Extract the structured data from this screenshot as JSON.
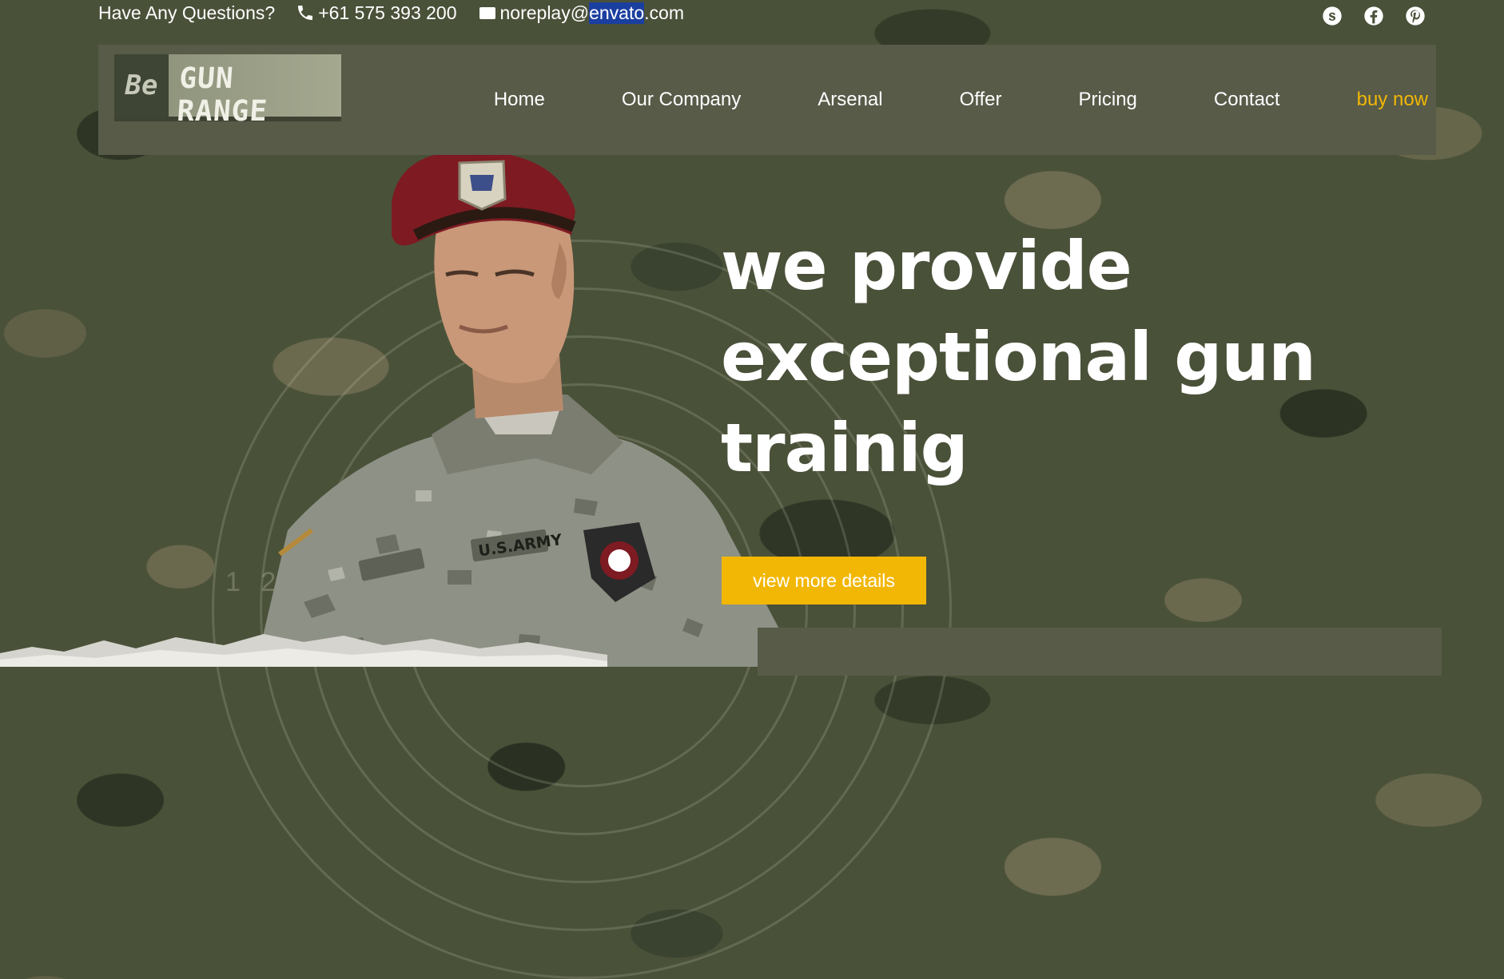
{
  "topbar": {
    "question": "Have Any Questions?",
    "phone": "+61 575 393 200",
    "email_prefix": "noreplay@",
    "email_domain": "envato",
    "email_suffix": ".com",
    "icons": [
      "phone-icon",
      "envelope-icon"
    ]
  },
  "socials": [
    "skype-icon",
    "facebook-icon",
    "pinterest-icon"
  ],
  "logo": {
    "be": "Be",
    "name": "GUN RANGE"
  },
  "nav": {
    "items": [
      "Home",
      "Our Company",
      "Arsenal",
      "Offer",
      "Pricing",
      "Contact"
    ],
    "buy": "buy now"
  },
  "hero": {
    "line1": "we provide",
    "line2": "exceptional gun",
    "line3": "trainig",
    "cta": "view more details",
    "target_numbers": "1 2 3"
  },
  "colors": {
    "accent": "#f2b705",
    "nav_bg": "#575b48",
    "camo_base": "#4a5139"
  }
}
